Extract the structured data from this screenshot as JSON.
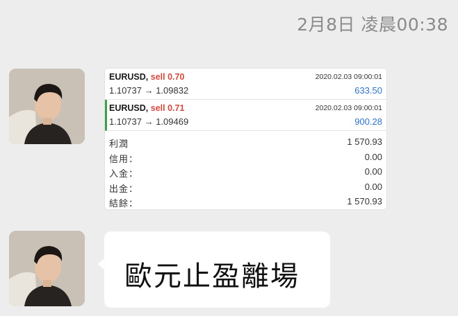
{
  "chat": {
    "timestamp": "2月8日 凌晨00:38"
  },
  "trade_card": {
    "trades": [
      {
        "symbol": "EURUSD,",
        "side": "sell 0.70",
        "datetime": "2020.02.03 09:00:01",
        "prices": "1.10737 → 1.09832",
        "profit": "633.50"
      },
      {
        "symbol": "EURUSD,",
        "side": "sell 0.71",
        "datetime": "2020.02.03 09:00:01",
        "prices": "1.10737 → 1.09469",
        "profit": "900.28"
      }
    ],
    "summary": [
      {
        "label": "利潤",
        "value": "1 570.93"
      },
      {
        "label": "信用：",
        "value": "0.00"
      },
      {
        "label": "入金：",
        "value": "0.00"
      },
      {
        "label": "出金：",
        "value": "0.00"
      },
      {
        "label": "結餘：",
        "value": "1 570.93"
      }
    ]
  },
  "message": {
    "text": "歐元止盈離場"
  },
  "colors": {
    "background": "#ededed",
    "sell": "#d24a3e",
    "profit": "#2f72c9",
    "selected_marker": "#3aa04a"
  },
  "icons": {
    "avatar": "user-avatar-photo"
  }
}
